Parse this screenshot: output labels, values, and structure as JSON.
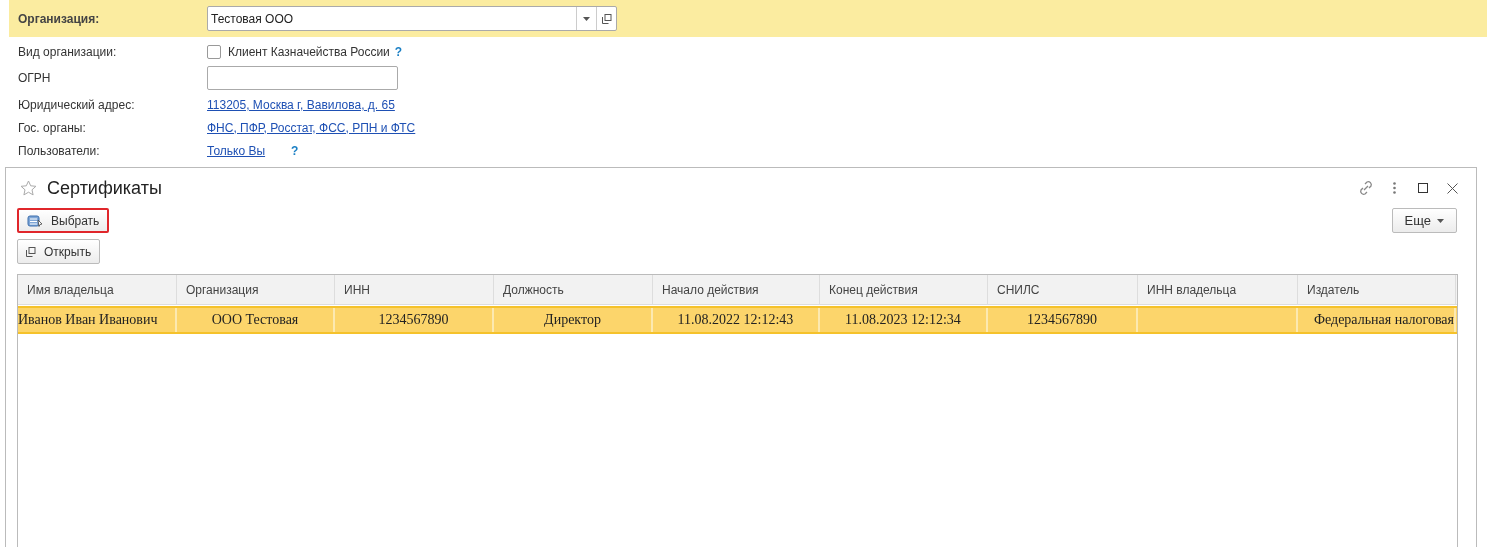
{
  "organization": {
    "label": "Организация:",
    "value": "Тестовая ООО"
  },
  "fields": [
    {
      "kind": "checkbox",
      "label": "Вид организации:",
      "text": "Клиент Казначейства России",
      "checked": false,
      "help": "?"
    },
    {
      "kind": "input",
      "label": "ОГРН"
    },
    {
      "kind": "link",
      "label": "Юридический адрес:",
      "text": "113205, Москва г, Вавилова, д. 65"
    },
    {
      "kind": "link",
      "label": "Гос. органы:",
      "text": "ФНС, ПФР, Росстат, ФСС, РПН и ФТС"
    },
    {
      "kind": "link",
      "label": "Пользователи:",
      "text": "Только Вы",
      "help": "?"
    }
  ],
  "window": {
    "title": "Сертификаты"
  },
  "buttons": [
    {
      "label": "Выбрать",
      "highlighted": true
    },
    {
      "label": "Открыть",
      "highlighted": false
    }
  ],
  "more_button": "Еще",
  "table": {
    "columns": [
      "Имя владельца",
      "Организация",
      "ИНН",
      "Должность",
      "Начало действия",
      "Конец действия",
      "СНИЛС",
      "ИНН владельца",
      "Издатель"
    ],
    "rows": [
      {
        "selected": true,
        "cells": [
          "Иванов Иван Иванович",
          "ООО Тестовая",
          "1234567890",
          "Директор",
          "11.08.2022 12:12:43",
          "11.08.2023 12:12:34",
          "1234567890",
          "",
          "Федеральная налоговая"
        ]
      }
    ]
  }
}
